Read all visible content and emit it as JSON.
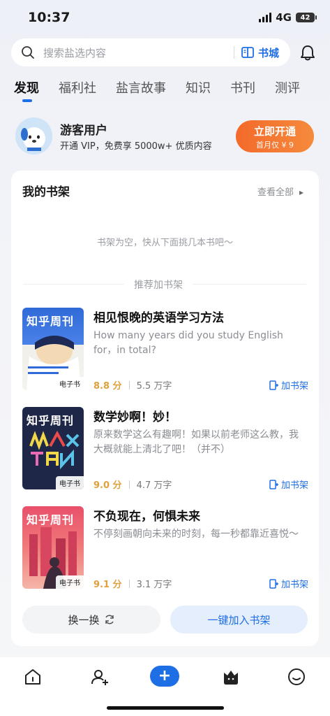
{
  "status": {
    "time": "10:37",
    "network": "4G",
    "battery": "42"
  },
  "search": {
    "placeholder": "搜索盐选内容",
    "bookstore_label": "书城"
  },
  "tabs": [
    {
      "label": "发现",
      "active": true
    },
    {
      "label": "福利社"
    },
    {
      "label": "盐言故事"
    },
    {
      "label": "知识"
    },
    {
      "label": "书刊"
    },
    {
      "label": "测评"
    }
  ],
  "member": {
    "name": "游客用户",
    "desc": "开通 VIP，免费享 5000w+ 优质内容",
    "cta": "立即开通",
    "cta_sub": "首月仅 ¥ 9"
  },
  "shelf": {
    "title": "我的书架",
    "view_all": "查看全部",
    "empty": "书架为空，快从下面挑几本书吧～",
    "recommend_label": "推荐加书架"
  },
  "books": [
    {
      "title": "相见恨晚的英语学习方法",
      "desc": "How many years did you study English for，in total?",
      "score": "8.8 分",
      "words": "5.5 万字",
      "badge": "电子书",
      "cover_head": "知乎周刊",
      "add": "加书架"
    },
    {
      "title": "数学妙啊！妙！",
      "desc": "原来数学这么有趣啊！如果以前老师这么教，我大概就能上清北了吧！（并不）",
      "score": "9.0 分",
      "words": "4.7 万字",
      "badge": "电子书",
      "cover_head": "知乎周刊",
      "add": "加书架"
    },
    {
      "title": "不负现在，何惧未来",
      "desc": "不停刻画朝向未来的时刻，每一秒都靠近喜悦～",
      "score": "9.1 分",
      "words": "3.1 万字",
      "badge": "电子书",
      "cover_head": "知乎周刊",
      "add": "加书架"
    }
  ],
  "actions": {
    "swap": "换一换",
    "add_all": "一键加入书架"
  },
  "bottom_nav": [
    "home-icon",
    "add-friend-icon",
    "plus-icon",
    "membership-icon",
    "profile-icon"
  ],
  "colors": {
    "accent": "#1e6fe6",
    "orange": "#f46a2b",
    "score": "#e0a03d"
  }
}
